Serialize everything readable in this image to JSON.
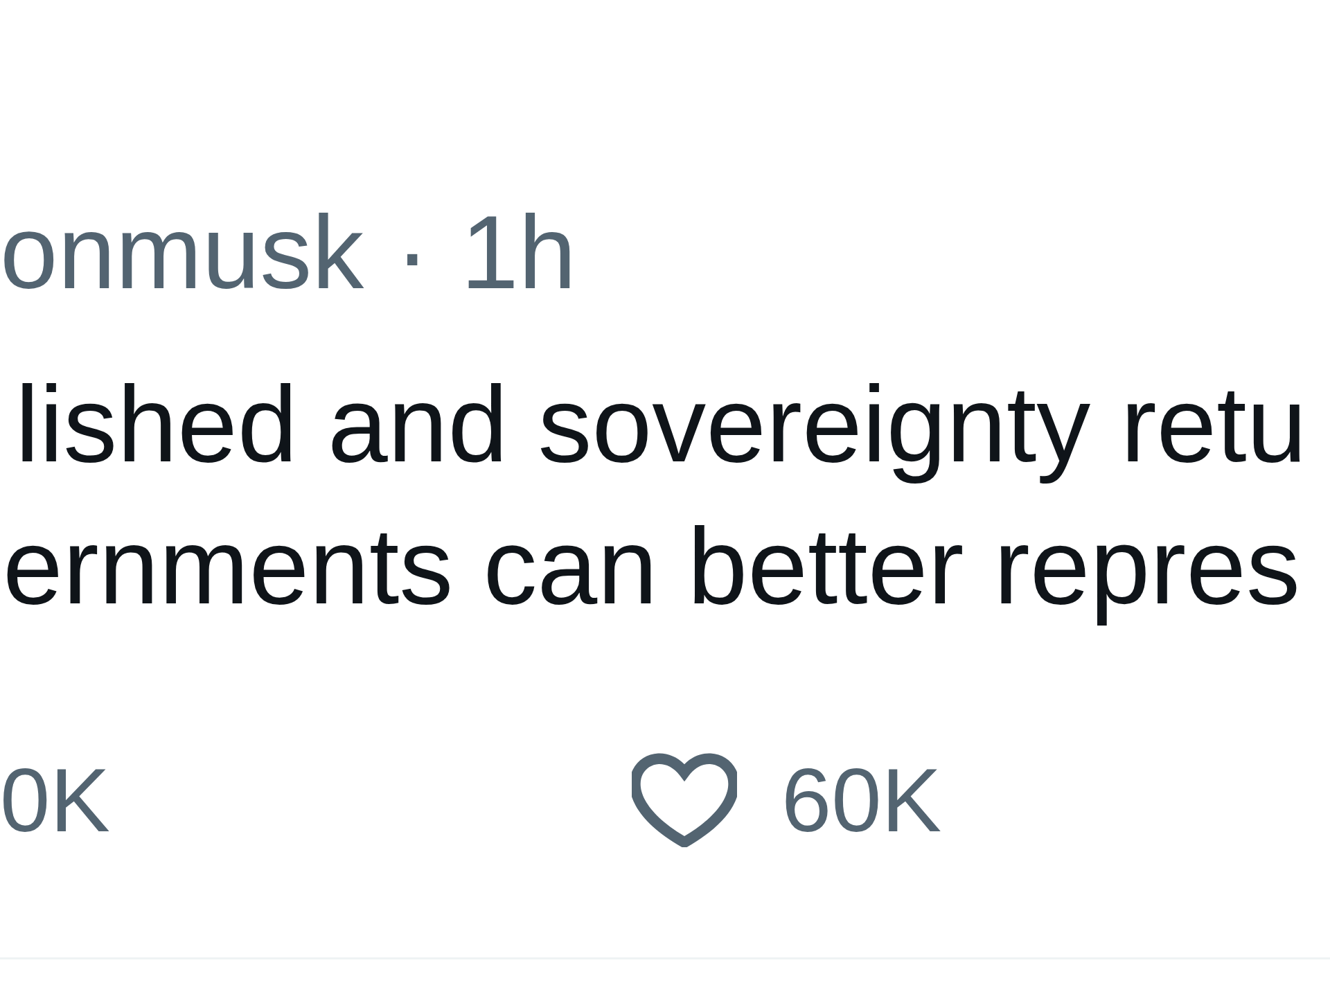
{
  "post": {
    "handle": "onmusk",
    "separator": "·",
    "time": "1h",
    "text_lines": [
      "lished and sovereignty retu",
      "ernments can better repres"
    ],
    "actions": [
      {
        "kind": "count",
        "count": "0K"
      },
      {
        "kind": "like",
        "count": "60K"
      }
    ]
  }
}
